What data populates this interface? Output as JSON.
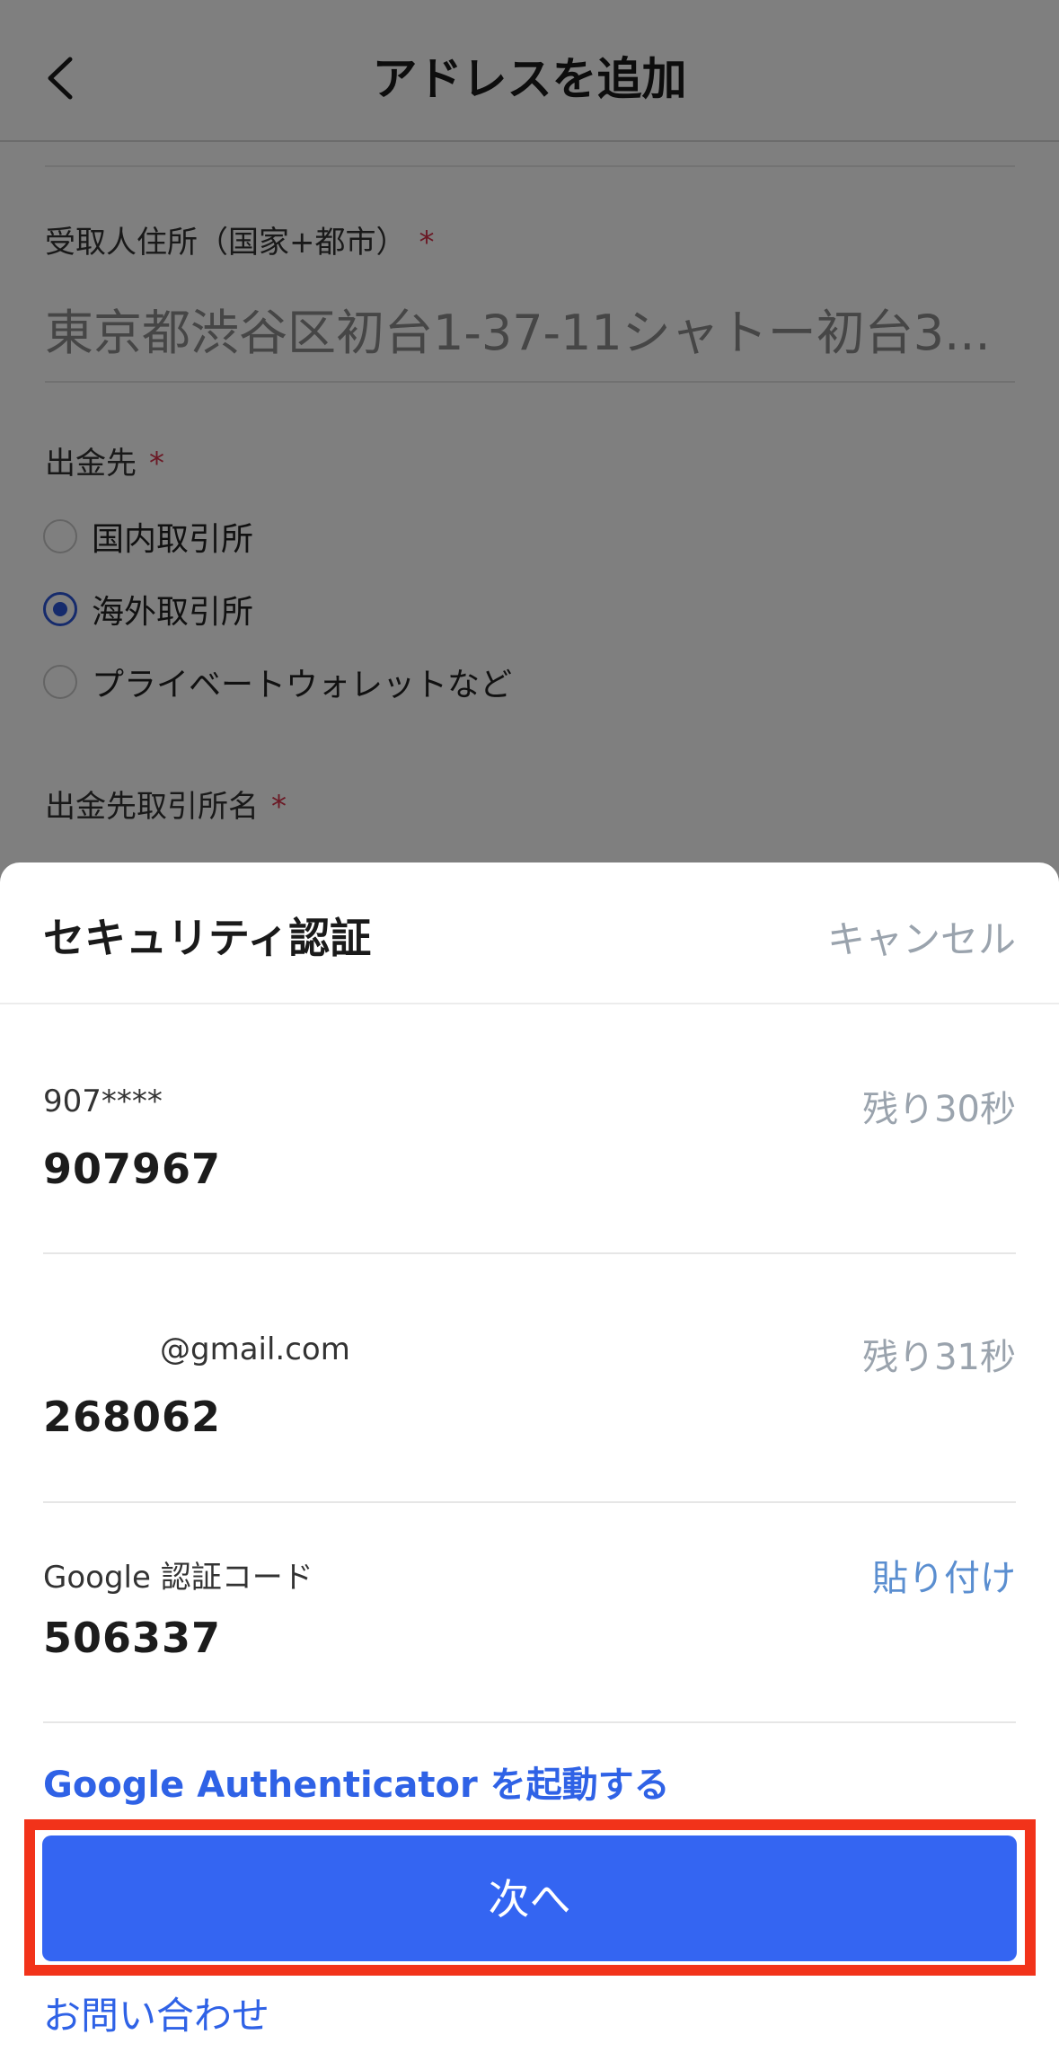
{
  "header": {
    "title": "アドレスを追加"
  },
  "form": {
    "address_label": "受取人住所（国家+都市）",
    "required_mark": "*",
    "address_value": "東京都渋谷区初台1-37-11シャトー初台3...",
    "destination_label": "出金先",
    "destination_options": [
      {
        "label": "国内取引所",
        "checked": false
      },
      {
        "label": "海外取引所",
        "checked": true
      },
      {
        "label": "プライベートウォレットなど",
        "checked": false
      }
    ],
    "exchange_name_label": "出金先取引所名"
  },
  "sheet": {
    "title": "セキュリティ認証",
    "cancel_label": "キャンセル",
    "sms": {
      "label": "907****",
      "timer": "残り30秒",
      "code": "907967"
    },
    "email": {
      "label": "@gmail.com",
      "timer": "残り31秒",
      "code": "268062"
    },
    "google": {
      "label": "Google 認証コード",
      "paste_label": "貼り付け",
      "code": "506337"
    },
    "authenticator_link": "Google Authenticator を起動する",
    "next_label": "次へ",
    "contact_link": "お問い合わせ"
  },
  "colors": {
    "accent": "#3465f2",
    "link": "#2f62e6",
    "highlight": "#f2331a",
    "required": "#d7324a"
  }
}
